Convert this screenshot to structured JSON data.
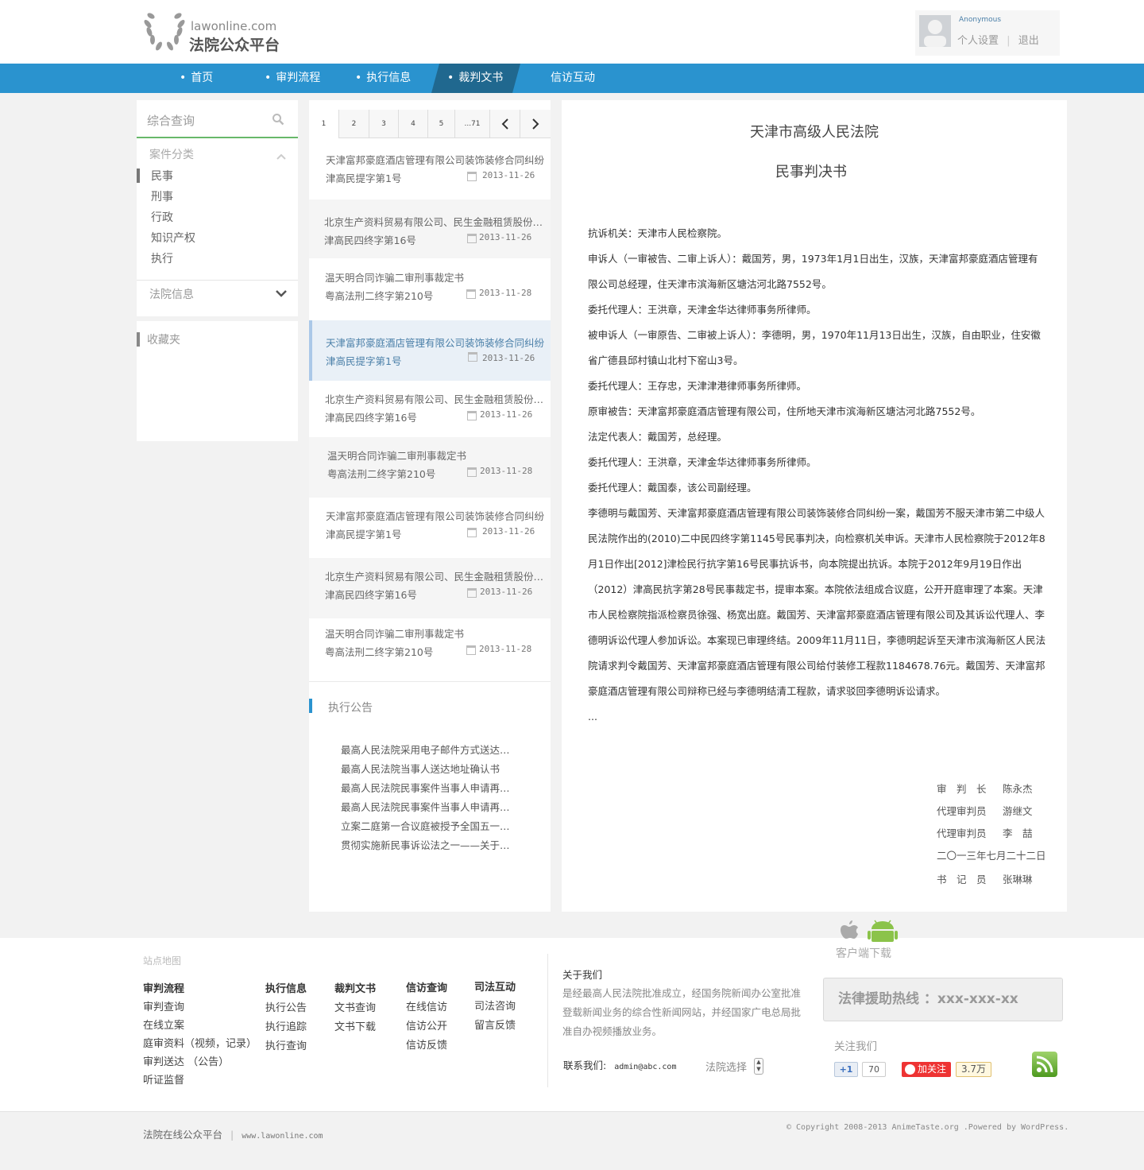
{
  "header": {
    "logo_domain": "lawonline.com",
    "logo_title": "法院公众平台",
    "user": {
      "name": "Anonymous",
      "settings_label": "个人设置",
      "divider": "|",
      "logout_label": "退出"
    }
  },
  "nav": {
    "bullet": "•",
    "items": [
      {
        "label": "首页",
        "active": false
      },
      {
        "label": "审判流程",
        "active": false
      },
      {
        "label": "执行信息",
        "active": false
      },
      {
        "label": "裁判文书",
        "active": true
      },
      {
        "label": "信访互动",
        "active": false
      }
    ]
  },
  "sidebar": {
    "search_label": "综合查询",
    "category_label": "案件分类",
    "categories": [
      "民事",
      "刑事",
      "行政",
      "知识产权",
      "执行"
    ],
    "court_info_label": "法院信息",
    "favorites_label": "收藏夹"
  },
  "pager": {
    "pages": [
      "1",
      "2",
      "3",
      "4",
      "5",
      "...71"
    ],
    "current": "1"
  },
  "cases": [
    {
      "title": "天津富邦豪庭酒店管理有限公司装饰装修合同纠纷",
      "number": "津高民提字第1号",
      "date": "2013-11-26"
    },
    {
      "title": "北京生产资料贸易有限公司、民生金融租赁股份有限公司",
      "number": "津高民四终字第16号",
      "date": "2013-11-26"
    },
    {
      "title": "温天明合同诈骗二审刑事裁定书",
      "number": "粤高法刑二终字第210号",
      "date": "2013-11-28"
    },
    {
      "title": "天津富邦豪庭酒店管理有限公司装饰装修合同纠纷",
      "number": "津高民提字第1号",
      "date": "2013-11-26"
    },
    {
      "title": "北京生产资料贸易有限公司、民生金融租赁股份有限公司",
      "number": "津高民四终字第16号",
      "date": "2013-11-26"
    },
    {
      "title": "温天明合同诈骗二审刑事裁定书",
      "number": "粤高法刑二终字第210号",
      "date": "2013-11-28"
    },
    {
      "title": "天津富邦豪庭酒店管理有限公司装饰装修合同纠纷",
      "number": "津高民提字第1号",
      "date": "2013-11-26"
    },
    {
      "title": "北京生产资料贸易有限公司、民生金融租赁股份有限公司",
      "number": "津高民四终字第16号",
      "date": "2013-11-26"
    },
    {
      "title": "温天明合同诈骗二审刑事裁定书",
      "number": "粤高法刑二终字第210号",
      "date": "2013-11-28"
    }
  ],
  "announcements": {
    "title": "执行公告",
    "items": [
      "最高人民法院采用电子邮件方式送达和传真",
      "最高人民法院当事人送达地址确认书",
      "最高人民法院民事案件当事人申请再审指南",
      "最高人民法院民事案件当事人申请再审须知",
      "立案二庭第一合议庭被授予全国五一巾帼标兵岗",
      "贯彻实施新民事诉讼法之一——关于立案登记"
    ]
  },
  "document": {
    "court": "天津市高级人民法院",
    "type": "民事判决书",
    "paragraphs": [
      "抗诉机关：天津市人民检察院。",
      "申诉人（一审被告、二审上诉人）：戴国芳，男，1973年1月1日出生，汉族，天津富邦豪庭酒店管理有限公司总经理，住天津市滨海新区塘沽河北路7552号。",
      "委托代理人：王洪章，天津金华达律师事务所律师。",
      "被申诉人（一审原告、二审被上诉人）：李德明，男，1970年11月13日出生，汉族，自由职业，住安徽省广德县邱村镇山北村下窑山3号。",
      "委托代理人：王存忠，天津津港律师事务所律师。",
      "原审被告：天津富邦豪庭酒店管理有限公司，住所地天津市滨海新区塘沽河北路7552号。",
      "法定代表人：戴国芳，总经理。",
      "委托代理人：王洪章，天津金华达律师事务所律师。",
      "委托代理人：戴国泰，该公司副经理。",
      "李德明与戴国芳、天津富邦豪庭酒店管理有限公司装饰装修合同纠纷一案，戴国芳不服天津市第二中级人民法院作出的(2010)二中民四终字第1145号民事判决，向检察机关申诉。天津市人民检察院于2012年8月1日作出[2012]津检民行抗字第16号民事抗诉书，向本院提出抗诉。本院于2012年9月19日作出（2012）津高民抗字第28号民事裁定书，提审本案。本院依法组成合议庭，公开开庭审理了本案。天津市人民检察院指派检察员徐强、杨宽出庭。戴国芳、天津富邦豪庭酒店管理有限公司及其诉讼代理人、李德明诉讼代理人参加诉讼。本案现已审理终结。2009年11月11日，李德明起诉至天津市滨海新区人民法院请求判令戴国芳、天津富邦豪庭酒店管理有限公司给付装修工程款1184678.76元。戴国芳、天津富邦豪庭酒店管理有限公司辩称已经与李德明结清工程款，请求驳回李德明诉讼请求。",
      "..."
    ],
    "signatures": [
      {
        "role": "审　判　长",
        "name": "陈永杰"
      },
      {
        "role": "代理审判员",
        "name": "游继文"
      },
      {
        "role": "代理审判员",
        "name": "李　喆"
      },
      {
        "role": "二〇一三年七月二十二日",
        "name": ""
      },
      {
        "role": "书　记　员",
        "name": "张琳琳"
      }
    ]
  },
  "footer": {
    "sitemap_label": "站点地图",
    "columns": [
      {
        "title": "审判流程",
        "links": [
          "审判查询",
          "在线立案",
          "庭审资料（视频，记录）",
          "审判送达 （公告）",
          "听证监督"
        ]
      },
      {
        "title": "执行信息",
        "links": [
          "执行公告",
          "执行追踪",
          "执行查询"
        ]
      },
      {
        "title": "裁判文书",
        "links": [
          "文书查询",
          "文书下载"
        ]
      },
      {
        "title": "信访查询",
        "links": [
          "在线信访",
          "信访公开",
          "信访反馈"
        ]
      },
      {
        "title": "司法互动",
        "links": [
          "司法咨询",
          "留言反馈"
        ]
      }
    ],
    "about_title": "关于我们",
    "about_text": "是经最高人民法院批准成立，经国务院新闻办公室批准登载新闻业务的综合性新闻网站，并经国家广电总局批准自办视频播放业务。",
    "contact_label": "联系我们:",
    "contact_email": "admin@abc.com",
    "court_select_label": "法院选择",
    "app_download_label": "客户端下载",
    "hotline": "法律援助热线 ：xxx-xxx-xx",
    "follow_label": "关注我们",
    "gplus_label": "+1",
    "gplus_count": "70",
    "weibo_label": "加关注",
    "weibo_count": "3.7万",
    "copyright_left": "法院在线公众平台",
    "copyright_left_url": "www.lawonline.com",
    "copyright_right": "© Copyright 2008-2013 AnimeTaste.org .Powered by WordPress."
  },
  "colors": {
    "nav": "#2a93cf",
    "nav_active": "#20688f",
    "accent_green": "#68b86a"
  }
}
